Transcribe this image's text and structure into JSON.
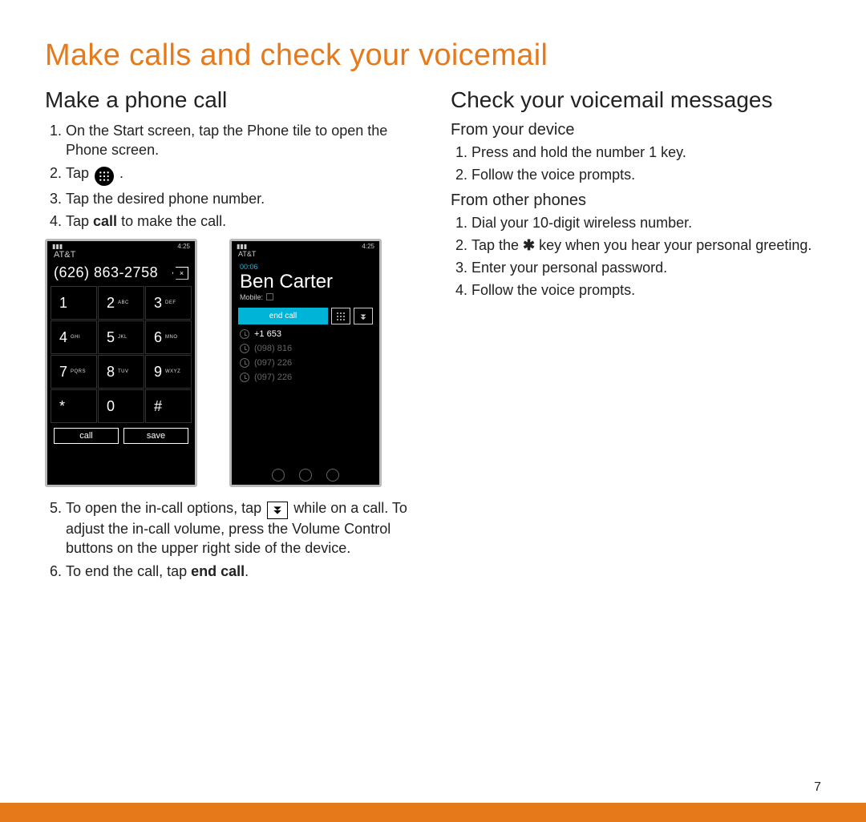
{
  "page": {
    "title": "Make calls and check your voicemail",
    "number": "7"
  },
  "left": {
    "heading": "Make a phone call",
    "steps": {
      "s1": "On the Start screen, tap the Phone tile to open the Phone screen.",
      "s2_pre": "Tap ",
      "s2_post": " .",
      "s3": "Tap the desired phone number.",
      "s4_pre": "Tap ",
      "s4_bold": "call",
      "s4_post": " to make the call.",
      "s5_pre": "To open the in-call options, tap ",
      "s5_post": " while on a call. To adjust the in-call volume, press the Volume Control buttons on the upper right side of the device.",
      "s6_pre": "To end the call, tap ",
      "s6_bold": "end call",
      "s6_post": "."
    }
  },
  "right": {
    "heading": "Check your voicemail messages",
    "sub1": "From your device",
    "device_steps": {
      "d1": "Press and hold the number 1 key.",
      "d2": "Follow the voice prompts."
    },
    "sub2": "From other phones",
    "other_steps": {
      "o1": "Dial your 10-digit wireless number.",
      "o2_pre": "Tap the ",
      "o2_star": "✱",
      "o2_post": " key when you hear your personal greeting.",
      "o3": "Enter your personal password.",
      "o4": "Follow the voice prompts."
    }
  },
  "phone1": {
    "time": "4:25",
    "carrier": "AT&T",
    "number": "(626) 863-2758",
    "keys": {
      "k1": "1",
      "k1l": "",
      "k2": "2",
      "k2l": "ABC",
      "k3": "3",
      "k3l": "DEF",
      "k4": "4",
      "k4l": "GHI",
      "k5": "5",
      "k5l": "JKL",
      "k6": "6",
      "k6l": "MNO",
      "k7": "7",
      "k7l": "PQRS",
      "k8": "8",
      "k8l": "TUV",
      "k9": "9",
      "k9l": "WXYZ",
      "kstar": "*",
      "k0": "0",
      "khash": "#"
    },
    "call_btn": "call",
    "save_btn": "save"
  },
  "phone2": {
    "time": "4:25",
    "carrier": "AT&T",
    "timer": "00:06",
    "name": "Ben Carter",
    "type": "Mobile:",
    "end_call": "end call",
    "recents": {
      "r1": "+1 653",
      "r2": "(098) 816",
      "r3": "(097) 226",
      "r4": "(097) 226"
    }
  },
  "icons": {
    "keypad": "keypad-icon",
    "dropdown": "dropdown-icon",
    "star": "star-icon",
    "backspace": "backspace-icon",
    "signal": "signal-icon"
  }
}
